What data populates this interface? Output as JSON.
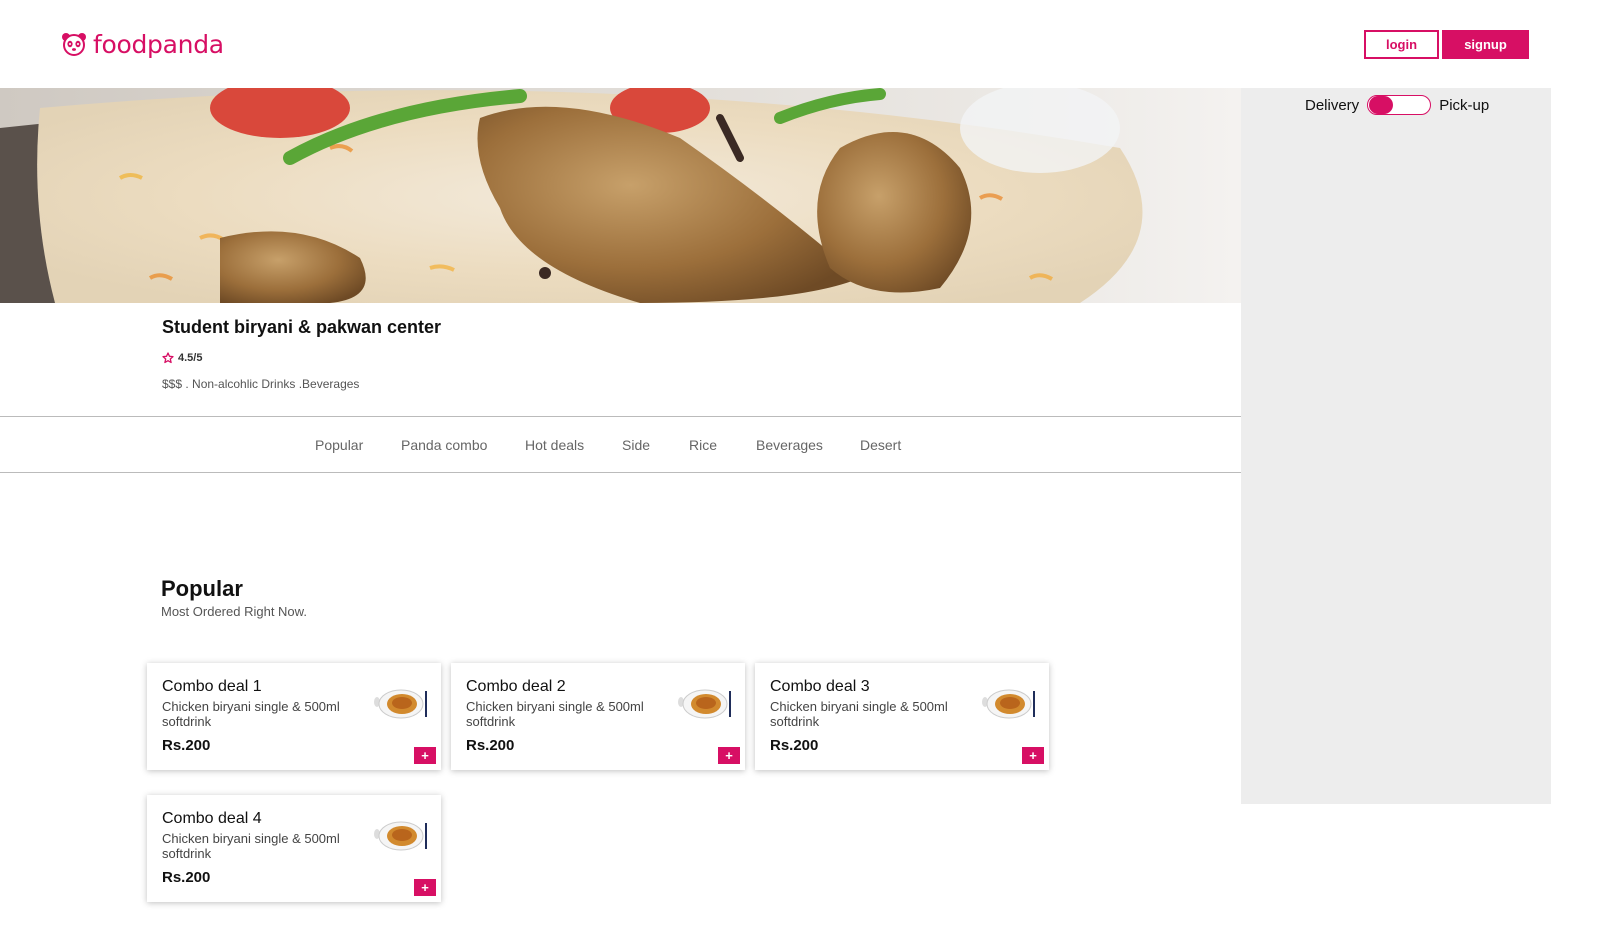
{
  "brand": {
    "name": "foodpanda",
    "color": "#d70f64",
    "logo_icon": "panda-icon"
  },
  "auth": {
    "login_label": "login",
    "signup_label": "signup"
  },
  "order_mode": {
    "left_label": "Delivery",
    "right_label": "Pick-up",
    "selected": "Delivery"
  },
  "restaurant": {
    "name": "Student biryani & pakwan center",
    "rating": "4.5/5",
    "tags": "$$$ . Non-alcohlic Drinks .Beverages"
  },
  "categories": [
    "Popular",
    "Panda combo",
    "Hot deals",
    "Side",
    "Rice",
    "Beverages",
    "Desert"
  ],
  "section": {
    "title": "Popular",
    "subtitle": "Most Ordered Right Now."
  },
  "items": [
    {
      "title": "Combo deal 1",
      "desc": "Chicken biryani single & 500ml softdrink",
      "price": "Rs.200",
      "add": "+"
    },
    {
      "title": "Combo deal 2",
      "desc": "Chicken biryani single & 500ml softdrink",
      "price": "Rs.200",
      "add": "+"
    },
    {
      "title": "Combo deal 3",
      "desc": "Chicken biryani single & 500ml softdrink",
      "price": "Rs.200",
      "add": "+"
    },
    {
      "title": "Combo deal 4",
      "desc": "Chicken biryani single & 500ml softdrink",
      "price": "Rs.200",
      "add": "+"
    }
  ]
}
